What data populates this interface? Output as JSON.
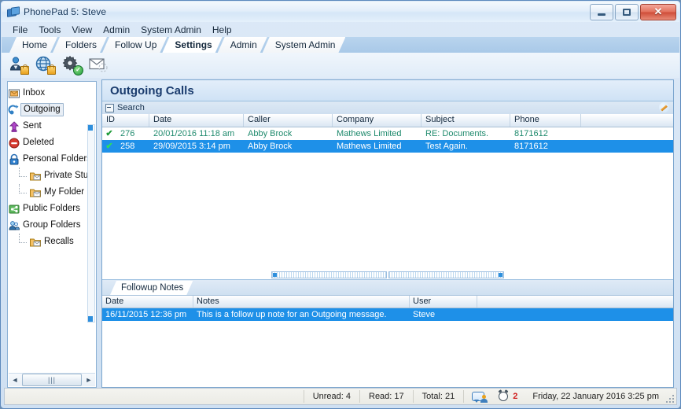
{
  "window": {
    "title": "PhonePad 5: Steve",
    "icon": "phonepad-logo-icon",
    "minimize_label": "",
    "maximize_label": "",
    "close_label": "✕"
  },
  "menubar": {
    "items": [
      {
        "label": "File"
      },
      {
        "label": "Tools"
      },
      {
        "label": "View"
      },
      {
        "label": "Admin"
      },
      {
        "label": "System Admin"
      },
      {
        "label": "Help"
      }
    ]
  },
  "tabs": {
    "items": [
      {
        "label": "Home",
        "active": false
      },
      {
        "label": "Folders",
        "active": false
      },
      {
        "label": "Follow Up",
        "active": false
      },
      {
        "label": "Settings",
        "active": true
      },
      {
        "label": "Admin",
        "active": false
      },
      {
        "label": "System Admin",
        "active": false
      }
    ]
  },
  "toolbar": {
    "buttons": [
      {
        "name": "user-lock-icon",
        "tooltip": "User Security"
      },
      {
        "name": "globe-lock-icon",
        "tooltip": "Network Security"
      },
      {
        "name": "gear-check-icon",
        "tooltip": "System Settings"
      },
      {
        "name": "envelope-icon",
        "tooltip": "Message Settings"
      }
    ]
  },
  "sidebar": {
    "items": [
      {
        "label": "Inbox",
        "icon": "inbox-icon",
        "indent": 0,
        "selected": false
      },
      {
        "label": "Outgoing",
        "icon": "outgoing-icon",
        "indent": 0,
        "selected": true
      },
      {
        "label": "Sent",
        "icon": "sent-icon",
        "indent": 0,
        "selected": false
      },
      {
        "label": "Deleted",
        "icon": "deleted-icon",
        "indent": 0,
        "selected": false
      },
      {
        "label": "Personal Folders",
        "icon": "personal-folders-icon",
        "indent": 0,
        "selected": false
      },
      {
        "label": "Private Stuff",
        "icon": "folder-icon",
        "indent": 1,
        "selected": false
      },
      {
        "label": "My Folder",
        "icon": "folder-icon",
        "indent": 1,
        "selected": false
      },
      {
        "label": "Public Folders",
        "icon": "public-folders-icon",
        "indent": 0,
        "selected": false
      },
      {
        "label": "Group Folders",
        "icon": "group-folders-icon",
        "indent": 0,
        "selected": false
      },
      {
        "label": "Recalls",
        "icon": "folder-icon",
        "indent": 1,
        "selected": false
      }
    ],
    "hscroll_grip": "|||",
    "left_arrow": "◄",
    "right_arrow": "►"
  },
  "main": {
    "title": "Outgoing Calls",
    "search": {
      "label": "Search",
      "expander": "expand-icon",
      "edit_icon": "pencil-icon"
    },
    "grid": {
      "columns": [
        "ID",
        "Date",
        "Caller",
        "Company",
        "Subject",
        "Phone"
      ],
      "rows": [
        {
          "flag": "✔",
          "id": "276",
          "date": "20/01/2016 11:18 am",
          "caller": "Abby Brock",
          "company": "Mathews Limited",
          "subject": "RE: Documents.",
          "phone": "8171612",
          "selected": false
        },
        {
          "flag": "✔",
          "id": "258",
          "date": "29/09/2015 3:14 pm",
          "caller": "Abby Brock",
          "company": "Mathews Limited",
          "subject": "Test Again.",
          "phone": "8171612",
          "selected": true
        }
      ]
    },
    "notes_panel": {
      "tab_label": "Followup Notes",
      "columns": [
        "Date",
        "Notes",
        "User"
      ],
      "rows": [
        {
          "date": "16/11/2015 12:36 pm",
          "notes": "This is a follow up note for an Outgoing message.",
          "user": "Steve",
          "selected": true
        }
      ]
    }
  },
  "statusbar": {
    "unread": "Unread: 4",
    "read": "Read: 17",
    "total": "Total: 21",
    "messenger_icon": "messenger-icon",
    "alarm_icon": "alarm-clock-icon",
    "alarm_count": "2",
    "datetime": "Friday, 22 January 2016  3:25 pm"
  },
  "colors": {
    "selection_blue": "#1e90e8",
    "grid_text_green": "#1f8a6d",
    "title_blue": "#1b3c6e",
    "alarm_red": "#d01b1b"
  }
}
